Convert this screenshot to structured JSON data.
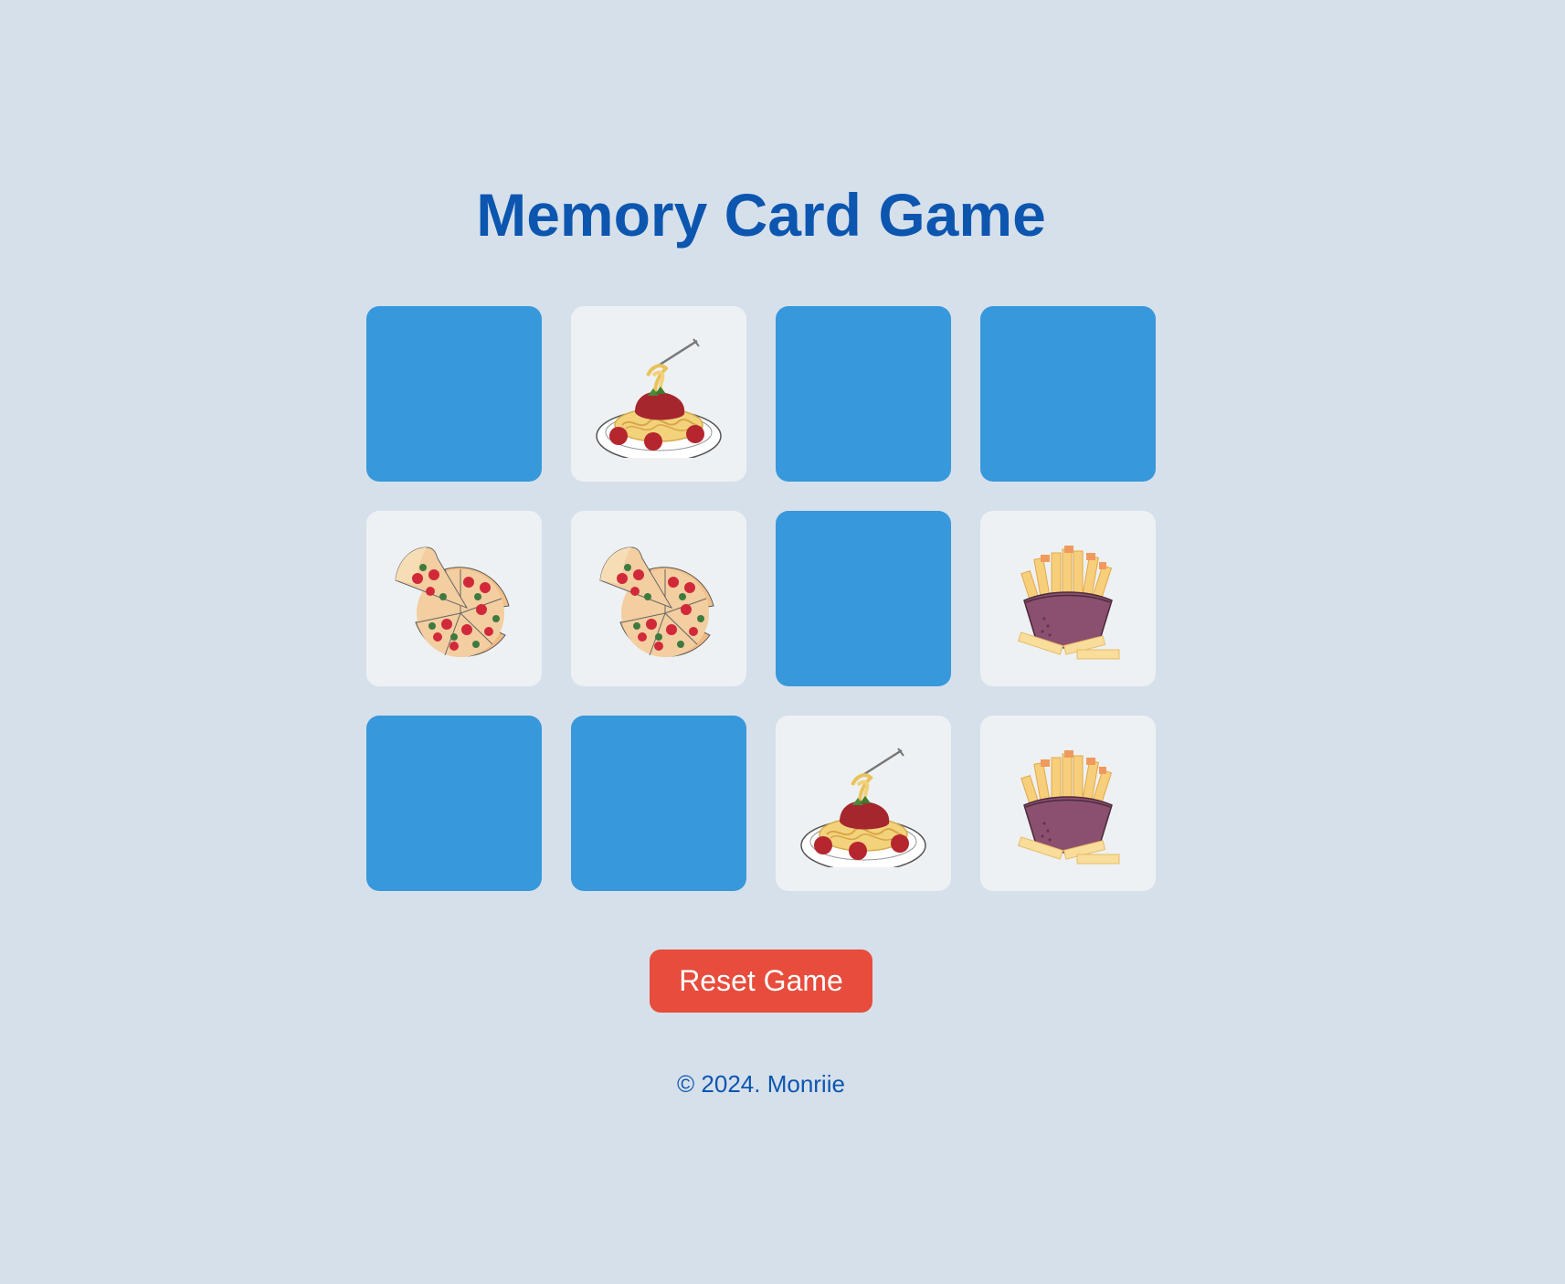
{
  "title": "Memory Card Game",
  "colors": {
    "background": "#d6e0eb",
    "title": "#0c56b0",
    "card_back": "#3798db",
    "card_face": "#eef1f3",
    "reset_button": "#e74c3c"
  },
  "board": {
    "columns": 4,
    "rows": 3,
    "cards": [
      {
        "state": "hidden",
        "image": null
      },
      {
        "state": "revealed",
        "image": "spaghetti-icon"
      },
      {
        "state": "hidden",
        "image": null
      },
      {
        "state": "hidden",
        "image": null
      },
      {
        "state": "revealed",
        "image": "pizza-icon"
      },
      {
        "state": "revealed",
        "image": "pizza-icon"
      },
      {
        "state": "hidden",
        "image": null
      },
      {
        "state": "revealed",
        "image": "fries-icon"
      },
      {
        "state": "hidden",
        "image": null
      },
      {
        "state": "hidden",
        "image": null
      },
      {
        "state": "revealed",
        "image": "spaghetti-icon"
      },
      {
        "state": "revealed",
        "image": "fries-icon"
      }
    ]
  },
  "reset_label": "Reset Game",
  "footer": "© 2024. Monriie"
}
